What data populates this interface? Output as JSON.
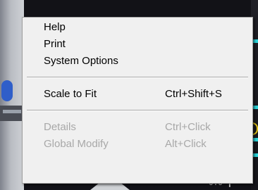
{
  "menu": {
    "groups": [
      {
        "items": [
          {
            "label": "Help",
            "enabled": true
          },
          {
            "label": "Print",
            "enabled": true
          },
          {
            "label": "System Options",
            "enabled": true
          }
        ]
      },
      {
        "items": [
          {
            "label": "Scale to Fit",
            "shortcut": "Ctrl+Shift+S",
            "enabled": true
          }
        ]
      },
      {
        "items": [
          {
            "label": "Details",
            "shortcut": "Ctrl+Click",
            "enabled": false
          },
          {
            "label": "Global Modify",
            "shortcut": "Alt+Click",
            "enabled": false
          }
        ]
      }
    ]
  },
  "background": {
    "readout": "0.0 ┏"
  },
  "colors": {
    "menu_bg": "#f0f0f0",
    "disabled_text": "#a8a8a8",
    "accent_cyan": "#2cd3d8",
    "accent_yellow": "#e0c21a",
    "accent_blue": "#2f5ec9"
  }
}
